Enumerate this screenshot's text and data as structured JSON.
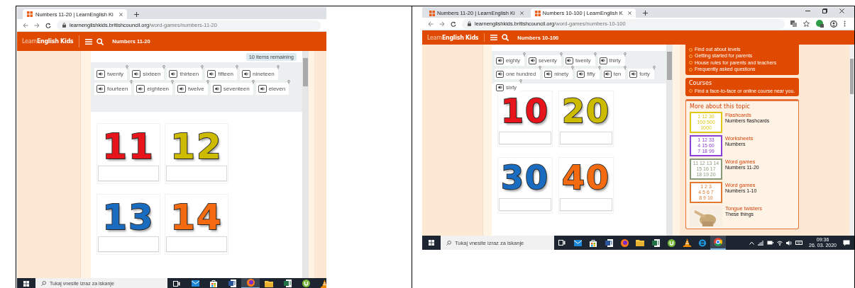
{
  "screenshots": [
    {
      "browser": {
        "tabs": [
          {
            "title": "Numbers 11-20 | LearnEnglish Ki",
            "selected": true
          }
        ],
        "url": {
          "host": "learnenglishkids.britishcouncil.org",
          "path": "/word-games/numbers-11-20"
        },
        "window_controls": false
      },
      "site": {
        "logo": "Learn**English Kids**",
        "page_title": "Numbers 11-20"
      },
      "game": {
        "remaining": "10 items remaining",
        "words": [
          "twenty",
          "sixteen",
          "thirteen",
          "fifteen",
          "nineteen",
          "fourteen",
          "eighteen",
          "twelve",
          "seventeen",
          "eleven"
        ],
        "cards": [
          {
            "number": "11",
            "color": "#e8141b"
          },
          {
            "number": "12",
            "color": "#cdbb00"
          },
          {
            "number": "13",
            "color": "#1a6cc0"
          },
          {
            "number": "14",
            "color": "#f36a10"
          }
        ]
      },
      "taskbar": {
        "search_placeholder": "Tukaj vnesite izraz za iskanje",
        "apps": [
          {
            "kind": "taskview",
            "selected": false
          },
          {
            "kind": "mail",
            "selected": false
          },
          {
            "kind": "store",
            "selected": false
          },
          {
            "kind": "word",
            "selected": false
          },
          {
            "kind": "firefox",
            "selected": true
          },
          {
            "kind": "explorer",
            "selected": false
          },
          {
            "kind": "excel",
            "selected": false
          },
          {
            "kind": "utorrent",
            "selected": false
          },
          {
            "kind": "vlc",
            "selected": false
          }
        ]
      }
    },
    {
      "browser": {
        "tabs": [
          {
            "title": "Numbers 11-20 | LearnEnglish Ki",
            "selected": false
          },
          {
            "title": "Numbers 10-100 | LearnEnglish K",
            "selected": true
          }
        ],
        "url": {
          "host": "learnenglishkids.britishcouncil.org",
          "path": "/word-games/numbers-10-100"
        },
        "window_controls": true,
        "toolbar_icons": [
          {
            "kind": "translate"
          },
          {
            "kind": "bookmark"
          },
          {
            "kind": "extension"
          },
          {
            "kind": "account"
          },
          {
            "kind": "more"
          }
        ]
      },
      "site": {
        "logo": "Learn**English Kids**",
        "page_title": "Numbers 10-100"
      },
      "game": {
        "words": [
          "eighty",
          "seventy",
          "twenty",
          "thirty",
          "one hundred",
          "ninety",
          "fifty",
          "ten",
          "forty",
          "sixty"
        ],
        "cards": [
          {
            "number": "10",
            "color": "#e8141b"
          },
          {
            "number": "20",
            "color": "#cdbb00"
          },
          {
            "number": "30",
            "color": "#1a6cc0"
          },
          {
            "number": "40",
            "color": "#f36a10"
          }
        ]
      },
      "sidebar": {
        "links": [
          "Find out about levels",
          "Getting started for parents",
          "House rules for parents and teachers",
          "Frequently asked questions"
        ],
        "courses": {
          "title": "Courses",
          "links": [
            "Find a face-to-face or online course near you."
          ]
        },
        "topic": {
          "title": "More about this topic",
          "items": [
            {
              "title": "Flashcards",
              "subtitle": "Numbers flashcards",
              "thumb": {
                "kind": "numbers",
                "color": "#e0c81a",
                "lines": [
                  "1 12 30",
                  "100 500",
                  "1000"
                ]
              }
            },
            {
              "title": "Worksheets",
              "subtitle": "Numbers",
              "thumb": {
                "kind": "numbers",
                "color": "#8a3fd6",
                "lines": [
                  "1 12 33",
                  "4 15 60",
                  "7 18 99"
                ]
              }
            },
            {
              "title": "Word games",
              "subtitle": "Numbers 11-20",
              "thumb": {
                "kind": "numbers",
                "color": "#8a9a78",
                "lines": [
                  "11 12 13 14",
                  "15 16 17",
                  "18 19 20"
                ]
              }
            },
            {
              "title": "Word games",
              "subtitle": "Numbers 1-10",
              "thumb": {
                "kind": "numbers",
                "color": "#e07a30",
                "lines": [
                  "1 2 3",
                  "4 5 6 7",
                  "8 9 10"
                ]
              }
            },
            {
              "title": "Tongue twisters",
              "subtitle": "These things"
            }
          ]
        }
      },
      "taskbar": {
        "search_placeholder": "Tukaj vnesite izraz za iskanje",
        "apps": [
          {
            "kind": "taskview",
            "selected": false
          },
          {
            "kind": "mail",
            "selected": false
          },
          {
            "kind": "store",
            "selected": false
          },
          {
            "kind": "word",
            "selected": false
          },
          {
            "kind": "firefox",
            "selected": false
          },
          {
            "kind": "explorer",
            "selected": false
          },
          {
            "kind": "excel",
            "selected": false
          },
          {
            "kind": "utorrent",
            "selected": false
          },
          {
            "kind": "vlc",
            "selected": false
          },
          {
            "kind": "ie",
            "selected": false
          },
          {
            "kind": "chrome",
            "selected": true
          }
        ],
        "tray": [
          {
            "kind": "chevron"
          },
          {
            "kind": "network"
          },
          {
            "kind": "battery"
          },
          {
            "kind": "wifi"
          },
          {
            "kind": "volume"
          },
          {
            "kind": "keyboard"
          }
        ],
        "clock": {
          "time": "09:36",
          "date": "26. 03. 2020"
        }
      }
    }
  ]
}
